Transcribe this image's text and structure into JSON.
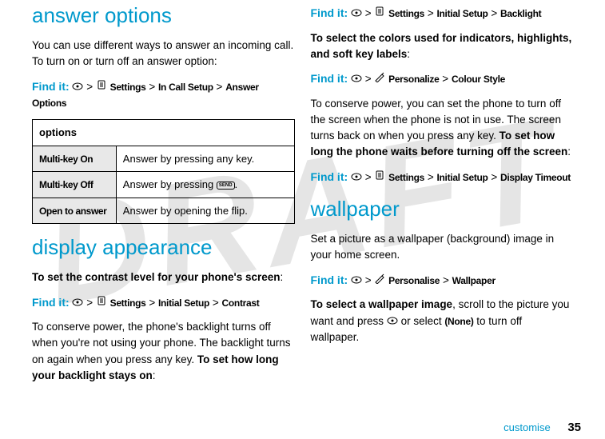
{
  "watermark": "DRAFT",
  "left": {
    "h_answer": "answer options",
    "p1": "You can use different ways to answer an incoming call. To turn on or turn off an answer option:",
    "find1_label": "Find it:",
    "find1_path_settings": "Settings",
    "find1_path_incall": "In Call Setup",
    "find1_path_ans": "Answer Options",
    "table": {
      "header": "options",
      "rows": [
        {
          "name": "Multi-key On",
          "desc_a": "Answer by pressing any key."
        },
        {
          "name": "Multi-key Off",
          "desc_a": "Answer by pressing ",
          "key": "SEND",
          "desc_b": "."
        },
        {
          "name": "Open to answer",
          "desc_a": "Answer by opening the flip."
        }
      ]
    },
    "h_display": "display appearance",
    "p2a": "To set the contrast level for your phone's screen",
    "find2_path_initial": "Initial Setup",
    "find2_path_contrast": "Contrast",
    "p3a": "To conserve power, the phone's backlight turns off when you're not using your phone. The backlight turns on again when you press any key. ",
    "p3b": "To set how long your backlight stays on",
    "colon": ":"
  },
  "right": {
    "find3_path_backlight": "Backlight",
    "p4a": "To select the colors used for indicators, highlights, and soft key labels",
    "find4_path_personalize": "Personalize",
    "find4_path_colour": "Colour Style",
    "p5a": "To conserve power, you can set the phone to turn off the screen when the phone is not in use. The screen turns back on when you press any key. ",
    "p5b": "To set how long the phone waits before turning off the screen",
    "find5_path_timeout": "Display Timeout",
    "h_wallpaper": "wallpaper",
    "p6": "Set a picture as a wallpaper (background) image in your home screen.",
    "find6_path_personalise": "Personalise",
    "find6_path_wallpaper": "Wallpaper",
    "p7a": "To select a wallpaper image",
    "p7b": ", scroll to the picture you want and press ",
    "p7c": " or select ",
    "p7_none": "(None)",
    "p7d": " to turn off wallpaper."
  },
  "nav": {
    "center": "s",
    "gt": ">",
    "settings_icon": "w",
    "personalize_icon": "l"
  },
  "footer": {
    "section": "customise",
    "page": "35"
  }
}
